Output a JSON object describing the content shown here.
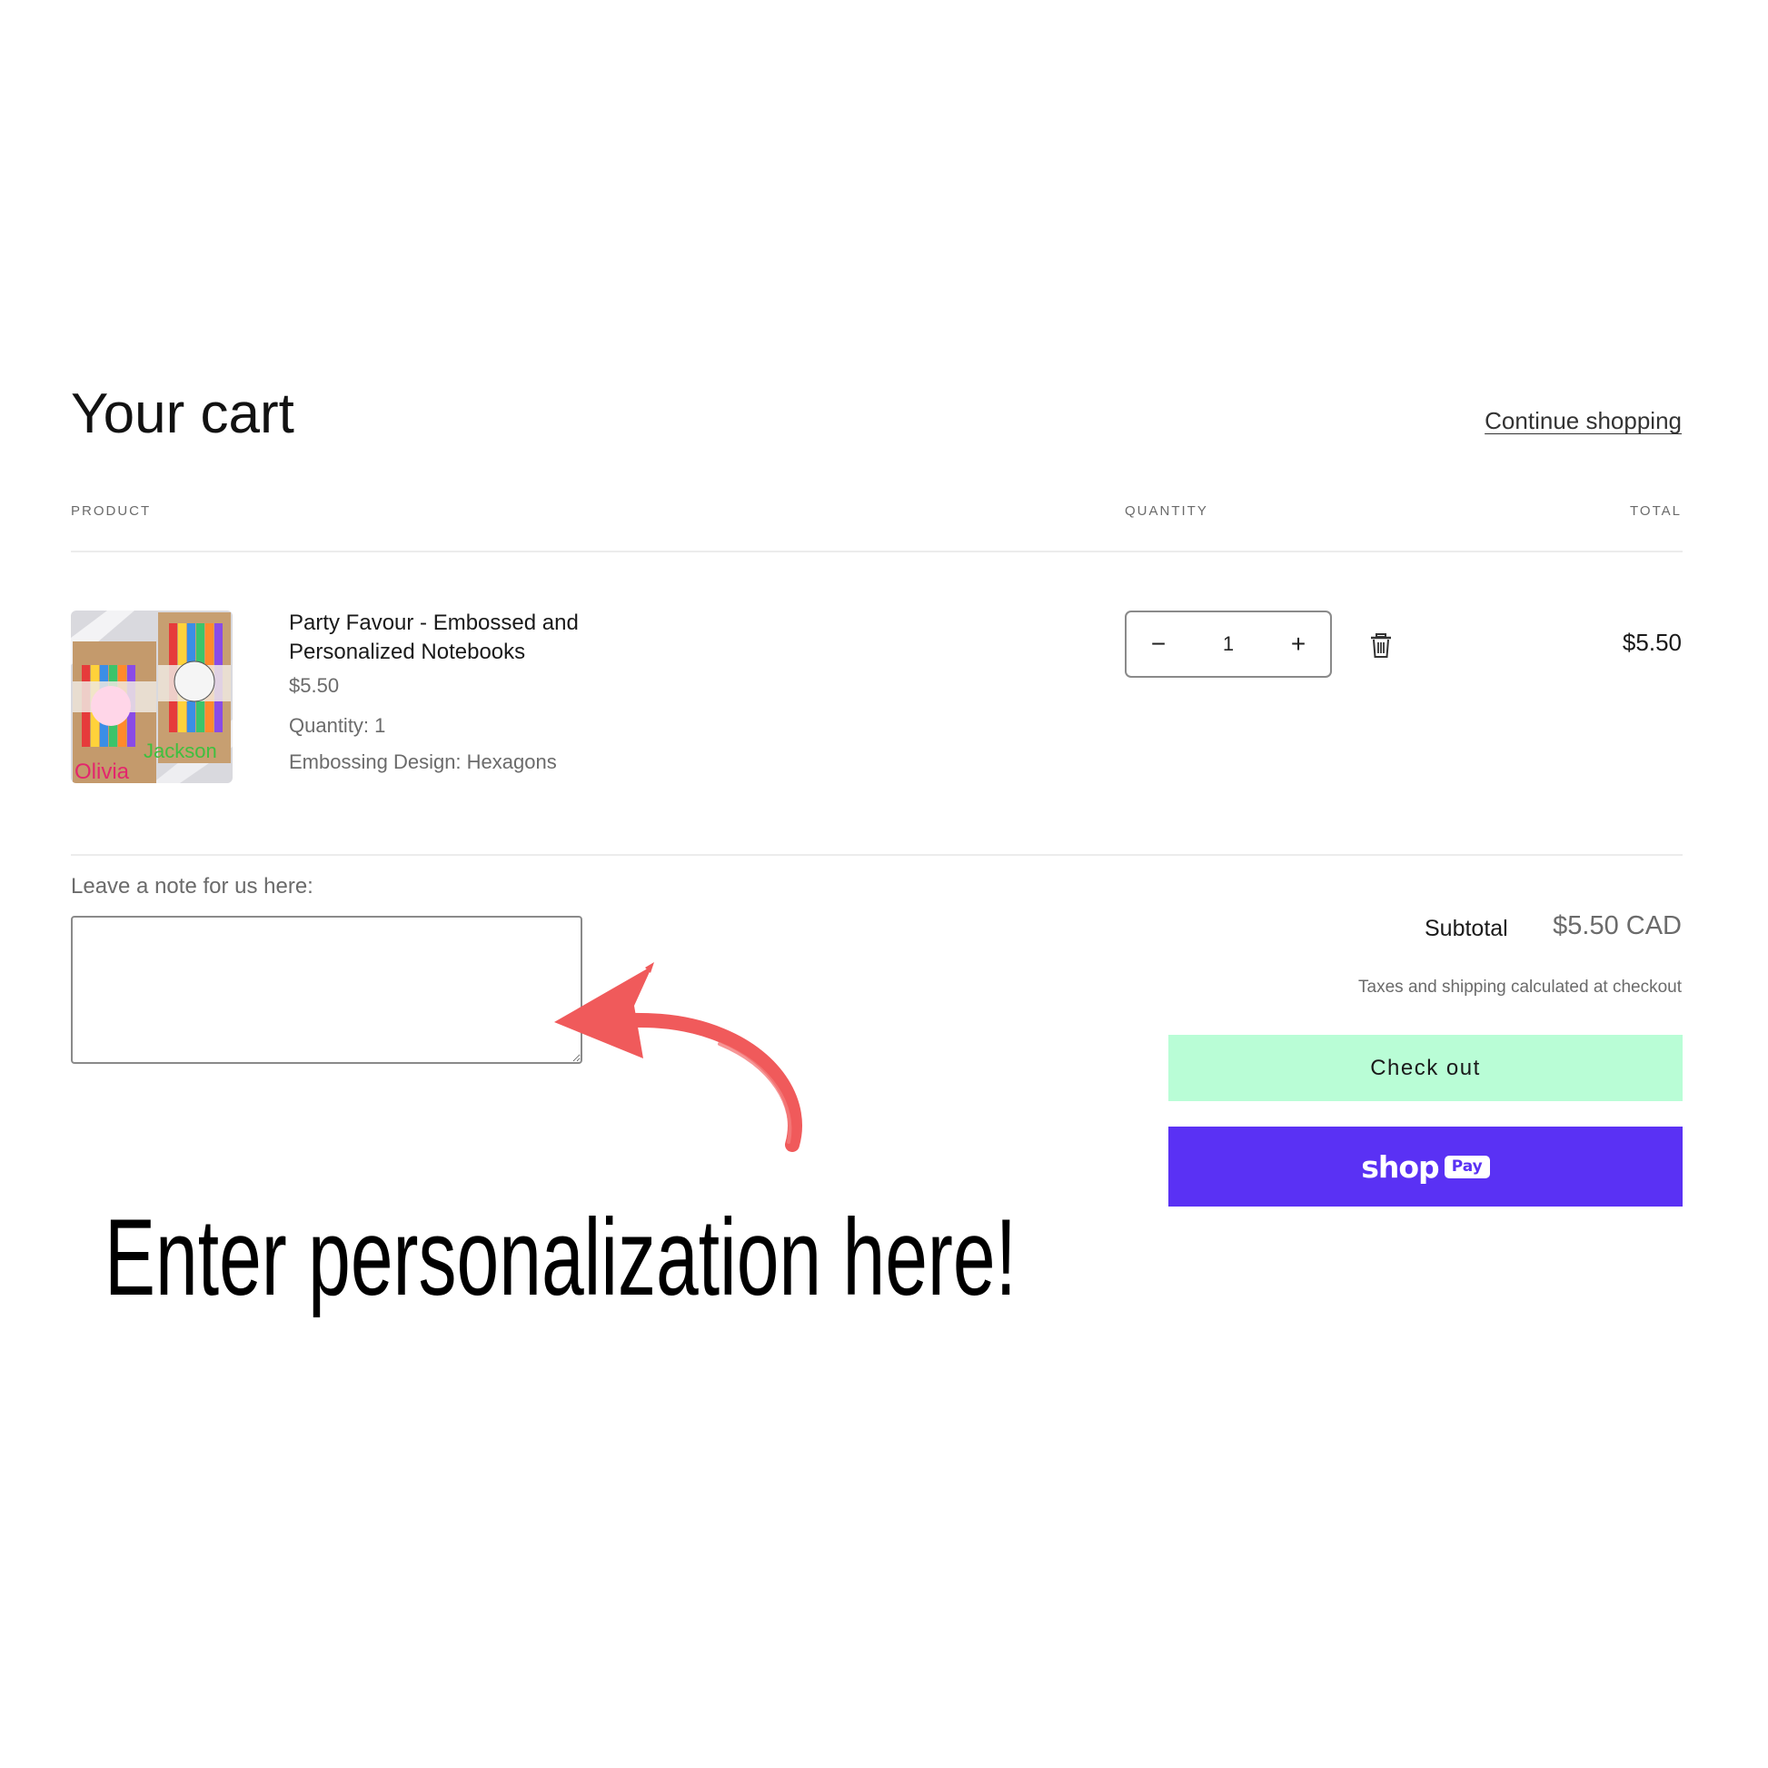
{
  "cart": {
    "title": "Your cart",
    "continue_label": "Continue shopping",
    "columns": {
      "product": "PRODUCT",
      "quantity": "QUANTITY",
      "total": "TOTAL"
    },
    "item": {
      "title": "Party Favour - Embossed and Personalized Notebooks",
      "price": "$5.50",
      "quantity_line": "Quantity: 1",
      "option_line": "Embossing Design: Hexagons",
      "qty_value": "1",
      "minus": "−",
      "plus": "+",
      "line_total": "$5.50",
      "thumb_labels": [
        "Olivia",
        "Jackson"
      ]
    },
    "note": {
      "label": "Leave a note for us here:",
      "value": ""
    },
    "summary": {
      "subtotal_label": "Subtotal",
      "subtotal_value": "$5.50 CAD",
      "tax_note": "Taxes and shipping calculated at checkout",
      "checkout_label": "Check out",
      "shoppay_word": "shop",
      "shoppay_pay": "Pay"
    }
  },
  "annotation": {
    "text": "Enter personalization here!"
  },
  "colors": {
    "checkout_bg": "#b9fdd6",
    "shoppay_bg": "#5a31f4",
    "arrow": "#f05a5b"
  },
  "icons": [
    "trash-icon",
    "minus-icon",
    "plus-icon",
    "red-arrow-icon"
  ]
}
